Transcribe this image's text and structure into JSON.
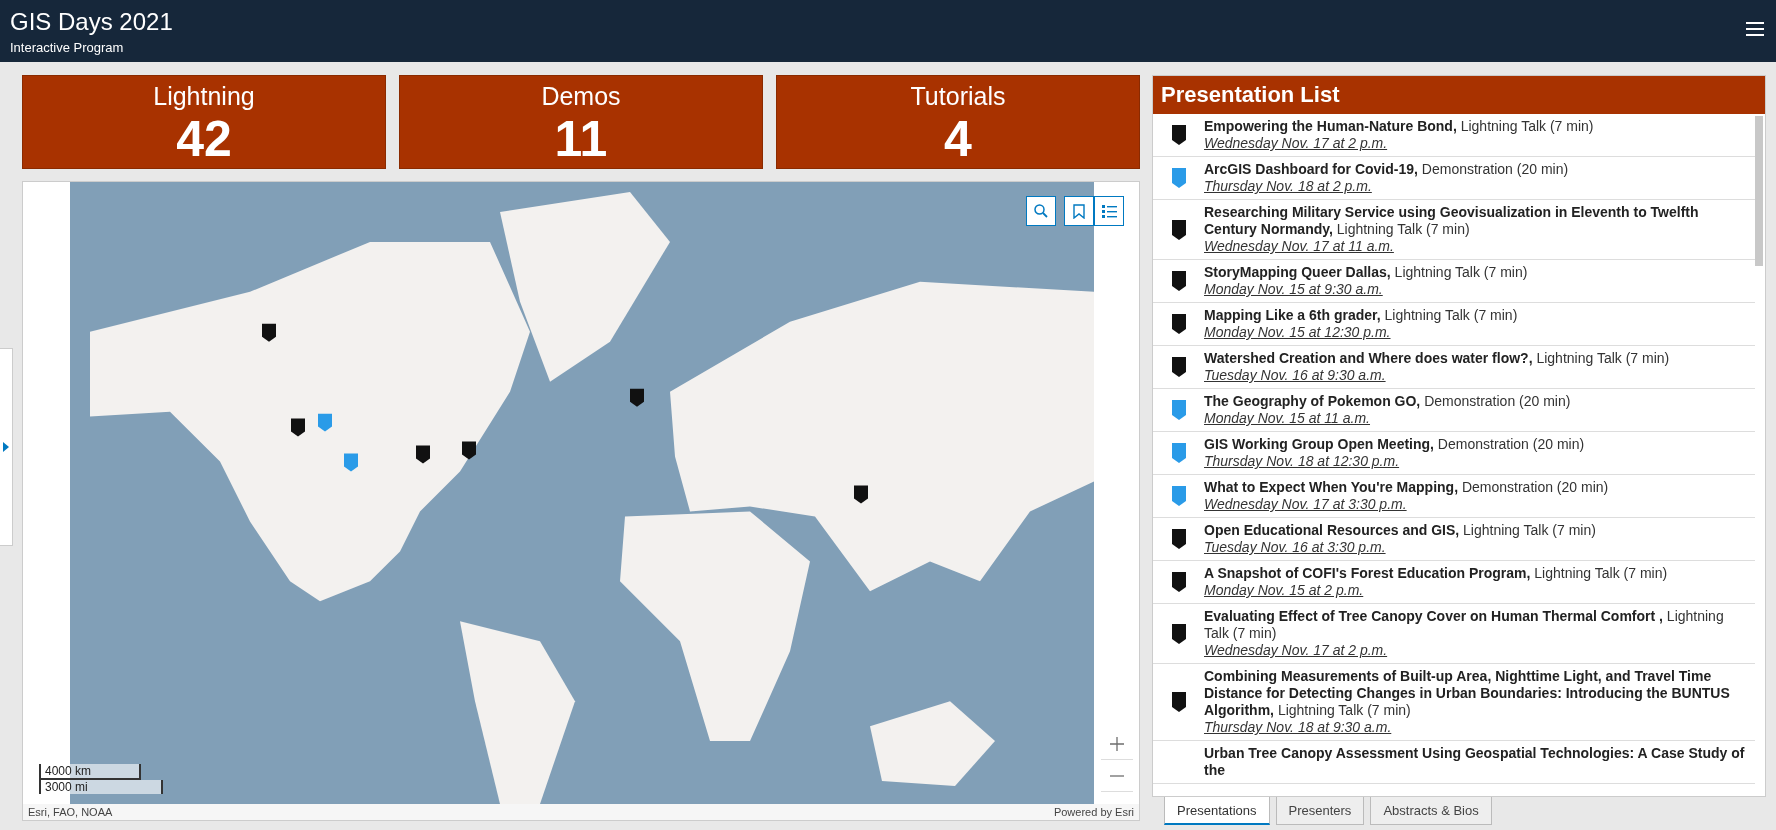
{
  "header": {
    "title": "GIS Days 2021",
    "subtitle": "Interactive Program"
  },
  "stats": [
    {
      "label": "Lightning",
      "value": "42"
    },
    {
      "label": "Demos",
      "value": "11"
    },
    {
      "label": "Tutorials",
      "value": "4"
    }
  ],
  "map": {
    "scale": [
      "4000 km",
      "3000 mi"
    ],
    "attribution": "Esri, FAO, NOAA",
    "powered_by": "Powered by Esri"
  },
  "presentation_list": {
    "title": "Presentation List",
    "items": [
      {
        "kind": "lightning",
        "title": "Empowering the Human-Nature Bond,",
        "type": "Lightning Talk (7 min)",
        "date": "Wednesday Nov. 17 at 2 p.m."
      },
      {
        "kind": "demo",
        "title": "ArcGIS Dashboard for Covid-19,",
        "type": "Demonstration (20 min)",
        "date": "Thursday Nov. 18 at 2 p.m."
      },
      {
        "kind": "lightning",
        "title": "Researching Military Service using Geovisualization in Eleventh to Twelfth Century Normandy,",
        "type": "Lightning Talk (7 min)",
        "date": "Wednesday Nov. 17 at 11 a.m."
      },
      {
        "kind": "lightning",
        "title": "StoryMapping Queer Dallas,",
        "type": "Lightning Talk (7 min)",
        "date": "Monday Nov. 15 at 9:30 a.m."
      },
      {
        "kind": "lightning",
        "title": "Mapping Like a 6th grader,",
        "type": "Lightning Talk (7 min)",
        "date": "Monday Nov. 15 at 12:30 p.m."
      },
      {
        "kind": "lightning",
        "title": "Watershed Creation and Where does water flow?,",
        "type": "Lightning Talk (7 min)",
        "date": "Tuesday Nov. 16 at 9:30 a.m."
      },
      {
        "kind": "demo",
        "title": "The Geography of Pokemon GO,",
        "type": "Demonstration (20 min)",
        "date": "Monday Nov. 15 at 11 a.m."
      },
      {
        "kind": "demo",
        "title": "GIS Working Group Open Meeting,",
        "type": "Demonstration (20 min)",
        "date": "Thursday Nov. 18 at 12:30 p.m."
      },
      {
        "kind": "demo",
        "title": "What to Expect When You're Mapping,",
        "type": "Demonstration (20 min)",
        "date": "Wednesday Nov. 17 at 3:30 p.m."
      },
      {
        "kind": "lightning",
        "title": "Open Educational Resources and GIS,",
        "type": "Lightning Talk (7 min)",
        "date": "Tuesday Nov. 16 at 3:30 p.m."
      },
      {
        "kind": "lightning",
        "title": "A Snapshot of COFI's Forest Education Program,",
        "type": "Lightning Talk (7 min)",
        "date": "Monday Nov. 15 at 2 p.m."
      },
      {
        "kind": "lightning",
        "title": "Evaluating Effect of Tree Canopy Cover on Human Thermal Comfort ,",
        "type": "Lightning Talk (7 min)",
        "date": "Wednesday Nov. 17 at 2 p.m."
      },
      {
        "kind": "lightning",
        "title": "Combining Measurements of Built-up Area, Nighttime Light, and Travel Time Distance for Detecting Changes in Urban Boundaries: Introducing the BUNTUS Algorithm,",
        "type": "Lightning Talk (7 min)",
        "date": "Thursday Nov. 18 at 9:30 a.m."
      },
      {
        "title": "Urban Tree Canopy Assessment Using Geospatial Technologies: A Case Study of the"
      }
    ]
  },
  "tabs": [
    {
      "label": "Presentations",
      "selected": true
    },
    {
      "label": "Presenters",
      "selected": false
    },
    {
      "label": "Abstracts & Bios",
      "selected": false
    }
  ]
}
